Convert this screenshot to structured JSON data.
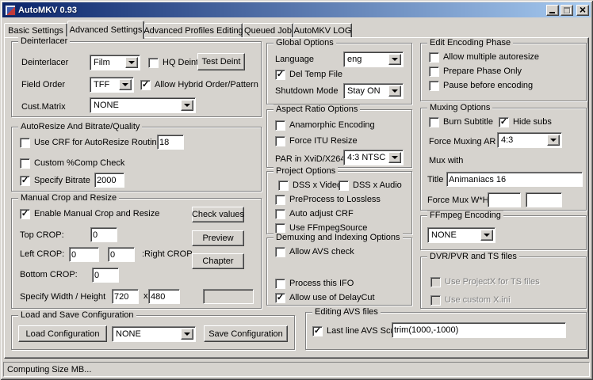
{
  "window": {
    "title": "AutoMKV 0.93",
    "status": "Computing Size MB..."
  },
  "tabs": [
    {
      "label": "Basic Settings"
    },
    {
      "label": "Advanced Settings"
    },
    {
      "label": "Advanced Profiles Editing"
    },
    {
      "label": "Queued Job"
    },
    {
      "label": "AutoMKV LOG"
    }
  ],
  "deinterlacer": {
    "title": "Deinterlacer",
    "deinterlacer_label": "Deinterlacer",
    "deinterlacer_value": "Film",
    "hq_deint": {
      "label": "HQ Deint",
      "checked": false
    },
    "test_deint_button": "Test Deint",
    "field_order_label": "Field Order",
    "field_order_value": "TFF",
    "allow_hybrid": {
      "label": "Allow Hybrid Order/Pattern",
      "checked": true
    },
    "cust_matrix_label": "Cust.Matrix",
    "cust_matrix_value": "NONE"
  },
  "autoresize": {
    "title": "AutoResize And Bitrate/Quality",
    "use_crf": {
      "label": "Use CRF for AutoResize Routines",
      "checked": false,
      "value": "18"
    },
    "custom_comp": {
      "label": "Custom %Comp Check",
      "checked": false
    },
    "specify_bitrate": {
      "label": "Specify Bitrate",
      "checked": true,
      "value": "2000"
    }
  },
  "manual_crop": {
    "title": "Manual Crop and Resize",
    "enable": {
      "label": "Enable Manual Crop and Resize",
      "checked": true
    },
    "check_values_button": "Check values",
    "preview_button": "Preview",
    "chapter_button": "Chapter",
    "top_label": "Top CROP:",
    "top_value": "0",
    "left_label": "Left CROP:",
    "left_value": "0",
    "right_value": "0",
    "right_label": ":Right CROP",
    "bottom_label": "Bottom CROP:",
    "bottom_value": "0",
    "wh_label": "Specify Width / Height",
    "width_value": "720",
    "x_sep": "x",
    "height_value": "480",
    "extra_value": ""
  },
  "load_save": {
    "title": "Load and Save Configuration",
    "load_button": "Load Configuration",
    "config_value": "NONE",
    "save_button": "Save Configuration"
  },
  "global_options": {
    "title": "Global Options",
    "language_label": "Language",
    "language_value": "eng",
    "del_temp": {
      "label": "Del Temp File",
      "checked": true
    },
    "shutdown_label": "Shutdown Mode",
    "shutdown_value": "Stay ON"
  },
  "aspect_ratio": {
    "title": "Aspect Ratio Options",
    "anamorphic": {
      "label": "Anamorphic Encoding",
      "checked": false
    },
    "force_itu": {
      "label": "Force ITU Resize",
      "checked": false
    },
    "par_label": "PAR in XviD/X264",
    "par_value": "4:3 NTSC"
  },
  "project_options": {
    "title": "Project Options",
    "dss_video": {
      "label": "DSS x Video",
      "checked": false
    },
    "dss_audio": {
      "label": "DSS x Audio",
      "checked": false
    },
    "preprocess": {
      "label": "PreProcess to Lossless",
      "checked": false
    },
    "auto_crf": {
      "label": "Auto adjust CRF",
      "checked": false
    },
    "ffmpegsource": {
      "label": "Use FFmpegSource",
      "checked": false
    }
  },
  "demuxing": {
    "title": "Demuxing and Indexing Options",
    "avs_check": {
      "label": "Allow AVS check",
      "checked": false
    },
    "process_ifo": {
      "label": "Process this IFO",
      "checked": false
    },
    "delaycut": {
      "label": "Allow use of DelayCut",
      "checked": true
    }
  },
  "editing_avs": {
    "title": "Editing AVS files",
    "last_line": {
      "label": "Last line AVS Script",
      "checked": true,
      "value": "trim(1000,-1000)"
    }
  },
  "edit_encoding": {
    "title": "Edit Encoding Phase",
    "multi_autoresize": {
      "label": "Allow multiple autoresize",
      "checked": false
    },
    "prepare_only": {
      "label": "Prepare Phase Only",
      "checked": false
    },
    "pause_before": {
      "label": "Pause before encoding",
      "checked": false
    }
  },
  "muxing": {
    "title": "Muxing Options",
    "burn_subtitle": {
      "label": "Burn Subtitle",
      "checked": false
    },
    "hide_subs": {
      "label": "Hide subs",
      "checked": true
    },
    "force_ar_label": "Force Muxing AR",
    "force_ar_value": "4:3",
    "mux_with_label": "Mux with",
    "title_label": "Title",
    "title_value": "Animaniacs 16",
    "force_wh_label": "Force Mux W*H",
    "force_w_value": "",
    "force_h_value": ""
  },
  "ffmpeg": {
    "title": "FFmpeg Encoding",
    "value": "NONE"
  },
  "dvr": {
    "title": "DVR/PVR and TS files",
    "projectx": {
      "label": "Use ProjectX for TS files",
      "checked": false
    },
    "custom_xini": {
      "label": "Use custom X.ini",
      "checked": false
    }
  }
}
